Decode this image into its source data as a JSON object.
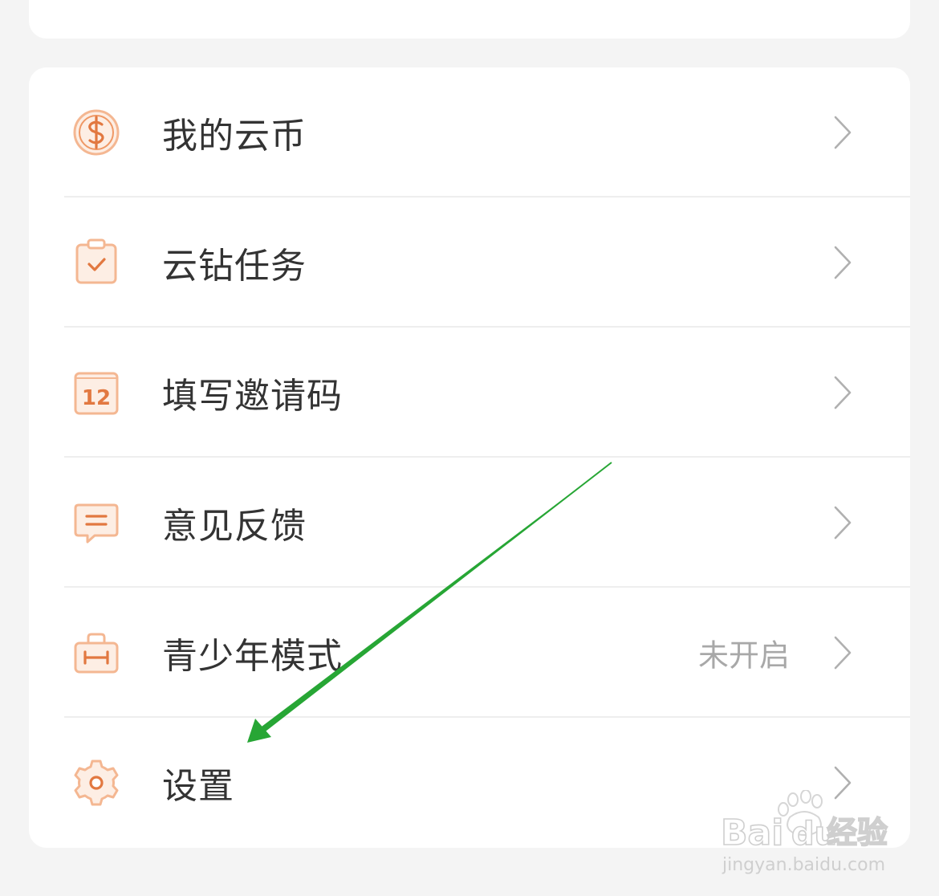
{
  "menu": {
    "items": [
      {
        "label": "我的云币",
        "icon": "coin-icon",
        "status": ""
      },
      {
        "label": "云钻任务",
        "icon": "clipboard-check-icon",
        "status": ""
      },
      {
        "label": "填写邀请码",
        "icon": "calendar-12-icon",
        "status": ""
      },
      {
        "label": "意见反馈",
        "icon": "message-icon",
        "status": ""
      },
      {
        "label": "青少年模式",
        "icon": "briefcase-icon",
        "status": "未开启"
      },
      {
        "label": "设置",
        "icon": "gear-icon",
        "status": ""
      }
    ]
  },
  "colors": {
    "accent": "#e8834e",
    "accent_light": "#f8d9c4",
    "annotation_arrow": "#27a635",
    "label_text": "#333333",
    "status_text": "#a8a8a8",
    "chevron": "#b0b0b0"
  },
  "watermark": {
    "brand": "Bai du 经验",
    "url": "jingyan.baidu.com"
  }
}
